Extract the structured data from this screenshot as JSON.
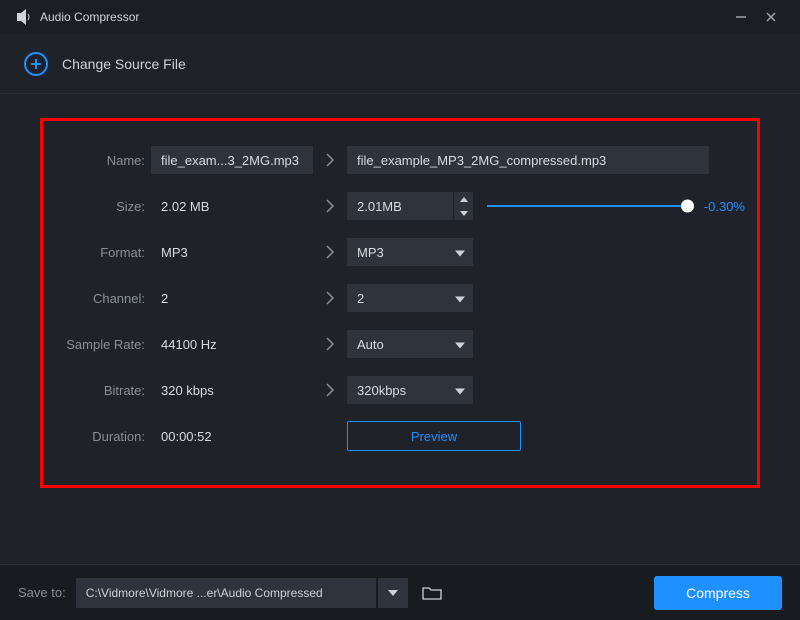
{
  "app": {
    "title": "Audio Compressor"
  },
  "toolbar": {
    "change_source": "Change Source File"
  },
  "labels": {
    "name": "Name:",
    "size": "Size:",
    "format": "Format:",
    "channel": "Channel:",
    "sample_rate": "Sample Rate:",
    "bitrate": "Bitrate:",
    "duration": "Duration:"
  },
  "source": {
    "name": "file_exam...3_2MG.mp3",
    "size": "2.02 MB",
    "format": "MP3",
    "channel": "2",
    "sample_rate": "44100 Hz",
    "bitrate": "320 kbps",
    "duration": "00:00:52"
  },
  "dest": {
    "name": "file_example_MP3_2MG_compressed.mp3",
    "size": "2.01MB",
    "size_delta": "-0.30%",
    "format": "MP3",
    "channel": "2",
    "sample_rate": "Auto",
    "bitrate": "320kbps"
  },
  "buttons": {
    "preview": "Preview",
    "compress": "Compress"
  },
  "footer": {
    "save_to_label": "Save to:",
    "save_path": "C:\\Vidmore\\Vidmore ...er\\Audio Compressed"
  },
  "colors": {
    "accent": "#1f90ff",
    "danger_frame": "#ff0000"
  }
}
